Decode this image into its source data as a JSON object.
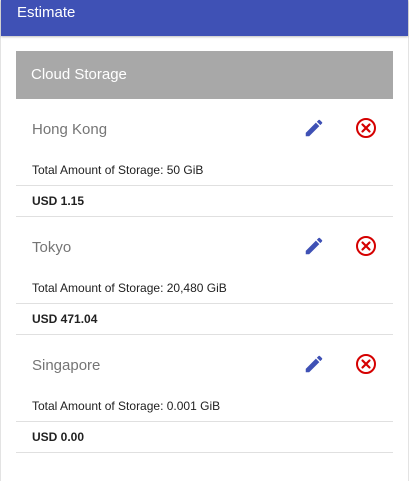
{
  "header": {
    "title": "Estimate"
  },
  "section": {
    "title": "Cloud Storage"
  },
  "items": [
    {
      "name": "Hong Kong",
      "detail": "Total Amount of Storage: 50 GiB",
      "price": "USD 1.15"
    },
    {
      "name": "Tokyo",
      "detail": "Total Amount of Storage: 20,480 GiB",
      "price": "USD 471.04"
    },
    {
      "name": "Singapore",
      "detail": "Total Amount of Storage: 0.001 GiB",
      "price": "USD 0.00"
    }
  ],
  "icons": {
    "edit": "pencil-icon",
    "delete": "close-circle-icon"
  },
  "colors": {
    "header_bg": "#3f51b5",
    "section_bg": "#a8a8a8",
    "edit": "#3f51b5",
    "delete": "#d50000"
  }
}
